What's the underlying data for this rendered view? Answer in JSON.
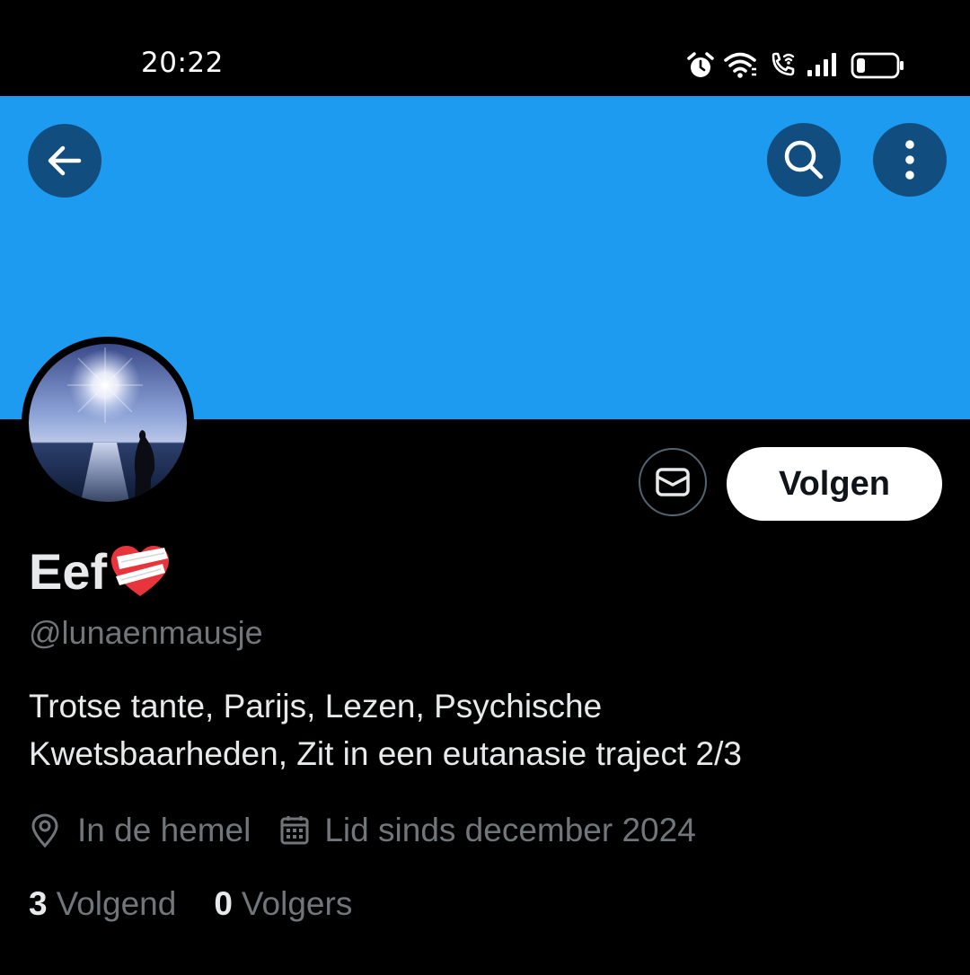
{
  "status_bar": {
    "time": "20:22",
    "icons": [
      "alarm-icon",
      "wifi-icon",
      "wifi-call-icon",
      "signal-icon",
      "battery-icon"
    ]
  },
  "banner": {
    "color": "#1d9bf0"
  },
  "header_buttons": {
    "back": "back-arrow-icon",
    "search": "search-icon",
    "more": "more-vertical-icon"
  },
  "actions": {
    "message_icon": "mail-icon",
    "follow_label": "Volgen"
  },
  "profile": {
    "display_name": "Eef",
    "name_emoji": "heart-with-bandage-icon",
    "handle": "@lunaenmausje",
    "bio_line1": "Trotse tante, Parijs, Lezen, Psychische",
    "bio_line2": "Kwetsbaarheden, Zit in een eutanasie traject 2/3",
    "location": "In de hemel",
    "joined": "Lid sinds december 2024"
  },
  "stats": {
    "following_count": "3",
    "following_label": "Volgend",
    "followers_count": "0",
    "followers_label": "Volgers"
  },
  "colors": {
    "accent": "#1d9bf0",
    "text_primary": "#e7e9ea",
    "text_secondary": "#71767b",
    "background": "#000000"
  }
}
